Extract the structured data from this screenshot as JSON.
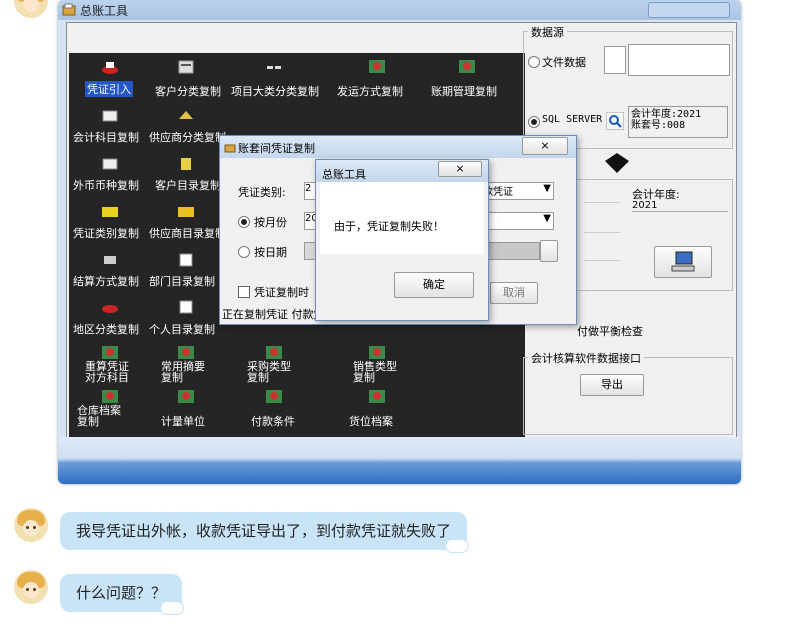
{
  "app": {
    "window_title": "总账工具"
  },
  "tools": [
    {
      "label": "凭证引入",
      "selected": true,
      "icon": "voucher-import-icon"
    },
    {
      "label": "客户分类复制",
      "icon": "customer-category-icon"
    },
    {
      "label": "项目大类分类复制",
      "icon": "project-category-icon"
    },
    {
      "label": "发运方式复制",
      "icon": "shipping-method-icon"
    },
    {
      "label": "账期管理复制",
      "icon": "account-period-icon"
    },
    {
      "label": "会计科目复制",
      "icon": "accounting-subject-icon"
    },
    {
      "label": "供应商分类复制",
      "icon": "supplier-category-icon"
    },
    {
      "label": "外币币种复制",
      "icon": "currency-icon"
    },
    {
      "label": "客户目录复制",
      "icon": "customer-directory-icon"
    },
    {
      "label": "凭证类别复制",
      "icon": "voucher-type-icon"
    },
    {
      "label": "供应商目录复制",
      "icon": "supplier-directory-icon"
    },
    {
      "label": "结算方式复制",
      "icon": "settlement-method-icon"
    },
    {
      "label": "部门目录复制",
      "icon": "department-directory-icon"
    },
    {
      "label": "地区分类复制",
      "icon": "region-category-icon"
    },
    {
      "label": "个人目录复制",
      "icon": "personal-directory-icon"
    },
    {
      "label": "重算凭证对方科目",
      "icon": "recalc-voucher-icon"
    },
    {
      "label": "常用摘要复制",
      "icon": "common-summary-icon"
    },
    {
      "label": "采购类型复制",
      "icon": "purchase-type-icon"
    },
    {
      "label": "销售类型复制",
      "icon": "sales-type-icon"
    },
    {
      "label": "仓库档案复制",
      "icon": "warehouse-file-icon"
    },
    {
      "label": "计量单位",
      "icon": "unit-of-measure-icon"
    },
    {
      "label": "付款条件",
      "icon": "payment-terms-icon"
    },
    {
      "label": "货位档案",
      "icon": "storage-location-icon"
    }
  ],
  "datasource": {
    "group_label": "数据源",
    "file_option": "文件数据",
    "sql_option": "SQL SERVER",
    "year_label": "会计年度:",
    "year_value": "2021",
    "book_label": "账套号:",
    "book_value": "008"
  },
  "target": {
    "year_label": "会计年度:",
    "year_value": "2021"
  },
  "balance_check_label": "付做平衡检查",
  "export_group": {
    "title": "会计核算软件数据接口",
    "button": "导出"
  },
  "copy_dialog": {
    "title": "账套间凭证复制",
    "voucher_type_label": "凭证类别:",
    "voucher_type_value": "2",
    "by_month_label": "按月份",
    "by_month_value": "20",
    "by_date_label": "按日期",
    "right_select_value": "款凭证",
    "right_select_value2": "2",
    "checkbox_label": "凭证复制时",
    "status_text": "正在复制凭证 付款凭证",
    "cancel_button": "取消"
  },
  "alert": {
    "title": "总账工具",
    "message": "由于，凭证复制失败！",
    "ok_button": "确定"
  },
  "chat": {
    "messages": [
      {
        "text": "我导凭证出外帐，收款凭证导出了，到付款凭证就失败了"
      },
      {
        "text": "什么问题？？"
      }
    ]
  }
}
